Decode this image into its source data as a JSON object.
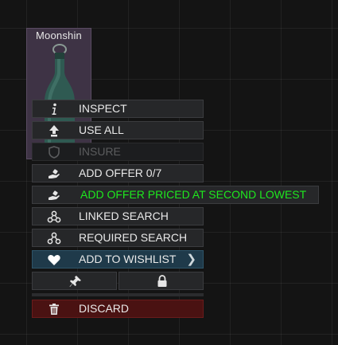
{
  "item": {
    "name": "Moonshin"
  },
  "context_menu": {
    "inspect": "INSPECT",
    "use_all": "USE ALL",
    "insure": "INSURE",
    "add_offer": "ADD OFFER 0/7",
    "add_offer_priced": "ADD OFFER PRICED AT SECOND LOWEST",
    "linked_search": "LINKED SEARCH",
    "required_search": "REQUIRED SEARCH",
    "add_to_wishlist": "ADD TO WISHLIST",
    "discard": "DISCARD"
  },
  "icons": {
    "inspect": "info-icon",
    "use_all": "upload-arrow-icon",
    "insure": "shield-icon",
    "add_offer": "hand-offer-icon",
    "linked_search": "linked-nodes-icon",
    "required_search": "required-nodes-icon",
    "wishlist": "heart-icon",
    "pin": "pin-icon",
    "lock": "lock-icon",
    "discard": "trash-icon",
    "submenu": "chevron-right-icon"
  },
  "colors": {
    "highlight_text": "#1ee81e",
    "wishlist_bg": "#1f3a4a",
    "discard_bg": "#4a1212",
    "item_slot_bg": "#3e3345"
  }
}
